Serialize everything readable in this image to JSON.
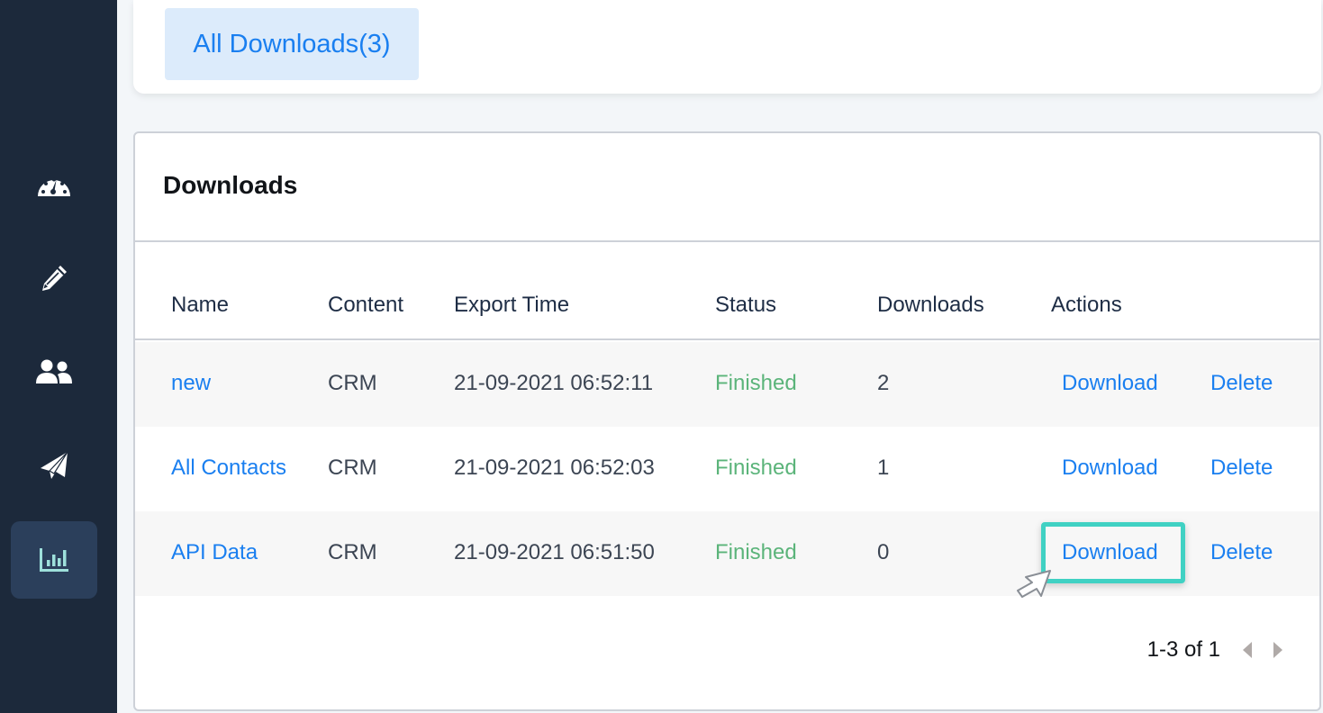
{
  "sidebar": {
    "items": [
      {
        "name": "dashboard",
        "icon": "speedometer-icon",
        "active": false
      },
      {
        "name": "editor",
        "icon": "pencil-icon",
        "active": false
      },
      {
        "name": "contacts",
        "icon": "users-icon",
        "active": false
      },
      {
        "name": "campaigns",
        "icon": "paper-plane-icon",
        "active": false
      },
      {
        "name": "reports",
        "icon": "bar-chart-icon",
        "active": true
      }
    ],
    "colors": {
      "background": "#1c293b",
      "active_bg": "#2b3f5b",
      "active_icon": "#9ee0db",
      "icon": "#ffffff"
    }
  },
  "tabs": {
    "all_downloads_label": "All Downloads(3)"
  },
  "downloads": {
    "title": "Downloads",
    "columns": [
      "Name",
      "Content",
      "Export Time",
      "Status",
      "Downloads",
      "Actions"
    ],
    "rows": [
      {
        "name": "new",
        "content": "CRM",
        "export_time": "21-09-2021 06:52:11",
        "status": "Finished",
        "downloads": "2",
        "download_label": "Download",
        "delete_label": "Delete"
      },
      {
        "name": "All Contacts",
        "content": "CRM",
        "export_time": "21-09-2021 06:52:03",
        "status": "Finished",
        "downloads": "1",
        "download_label": "Download",
        "delete_label": "Delete"
      },
      {
        "name": "API Data",
        "content": "CRM",
        "export_time": "21-09-2021 06:51:50",
        "status": "Finished",
        "downloads": "0",
        "download_label": "Download",
        "delete_label": "Delete"
      }
    ],
    "pagination": {
      "info": "1-3 of 1"
    }
  },
  "colors": {
    "link": "#1a7ff0",
    "status_finished": "#5bb47a",
    "highlight": "#40d1c3"
  }
}
